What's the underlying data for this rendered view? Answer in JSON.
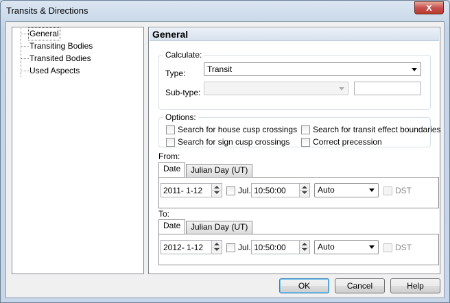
{
  "window": {
    "title": "Transits & Directions",
    "close_glyph": "X"
  },
  "tree": {
    "items": [
      {
        "label": "General",
        "selected": true
      },
      {
        "label": "Transiting Bodies"
      },
      {
        "label": "Transited Bodies"
      },
      {
        "label": "Used Aspects"
      }
    ]
  },
  "panel": {
    "title": "General",
    "calculate": {
      "legend": "Calculate:",
      "type_label": "Type:",
      "type_value": "Transit",
      "subtype_label": "Sub-type:",
      "subtype_value": "",
      "subtype_text": ""
    },
    "options": {
      "legend": "Options:",
      "house_cusp": "Search for house cusp crossings",
      "sign_cusp": "Search for sign cusp crossings",
      "effect_boundaries": "Search for transit effect boundaries",
      "correct_precession": "Correct precession"
    },
    "from": {
      "label": "From:",
      "tab_date": "Date",
      "tab_julian": "Julian Day (UT)",
      "date": "2011- 1-12",
      "jul_label": "Jul.",
      "time": "10:50:00",
      "zone": "Auto",
      "dst_label": "DST"
    },
    "to": {
      "label": "To:",
      "tab_date": "Date",
      "tab_julian": "Julian Day (UT)",
      "date": "2012- 1-12",
      "jul_label": "Jul.",
      "time": "10:50:00",
      "zone": "Auto",
      "dst_label": "DST"
    }
  },
  "buttons": {
    "ok": "OK",
    "cancel": "Cancel",
    "help": "Help"
  }
}
